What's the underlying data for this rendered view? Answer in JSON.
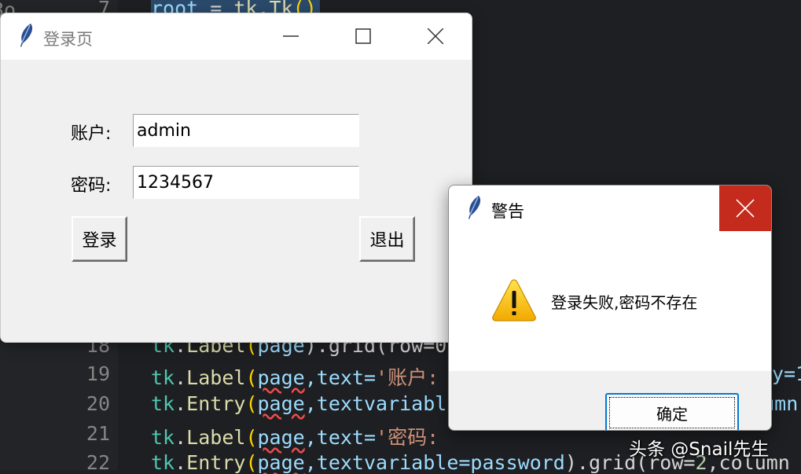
{
  "editor": {
    "line_numbers": [
      "7",
      "18",
      "19",
      "20",
      "21",
      "22"
    ],
    "lines": [
      {
        "cls": "root",
        "sep": " = ",
        "fn": "tk.Tk",
        "rest": "()"
      },
      {
        "cls": "tk",
        "dot": ".",
        "fn": "Label",
        "open": "(",
        "arg": "page",
        "rest": ").grid(row=0"
      },
      {
        "cls": "tk",
        "dot": ".",
        "fn": "Label",
        "open": "(",
        "arg": "page",
        "kw": ",text=",
        "str": "'账户:",
        "tail": "y=1"
      },
      {
        "cls": "tk",
        "dot": ".",
        "fn": "Entry",
        "open": "(",
        "arg": "page",
        "kw": ",textvariabl",
        "tail": "olumn"
      },
      {
        "cls": "tk",
        "dot": ".",
        "fn": "Label",
        "open": "(",
        "arg": "page",
        "kw": ",text=",
        "str": "'密码:"
      },
      {
        "cls": "tk",
        "dot": ".",
        "fn": "Entry",
        "open": "(",
        "arg": "page",
        "kw": ",textvariable=password",
        "rest": ").grid(row=",
        "num": "2",
        "tail2": ",column"
      }
    ],
    "corner_text": "8o"
  },
  "login_window": {
    "title": "登录页",
    "account_label": "账户:",
    "account_value": "admin",
    "password_label": "密码:",
    "password_value": "1234567",
    "login_button": "登录",
    "exit_button": "退出"
  },
  "dialog": {
    "title": "警告",
    "message": "登录失败,密码不存在",
    "ok_button": "确定"
  },
  "watermark": "头条 @Snail先生",
  "colors": {
    "dialog_close_bg": "#c42b1c",
    "ok_border": "#0078d4",
    "warning_yellow": "#f7c100"
  }
}
